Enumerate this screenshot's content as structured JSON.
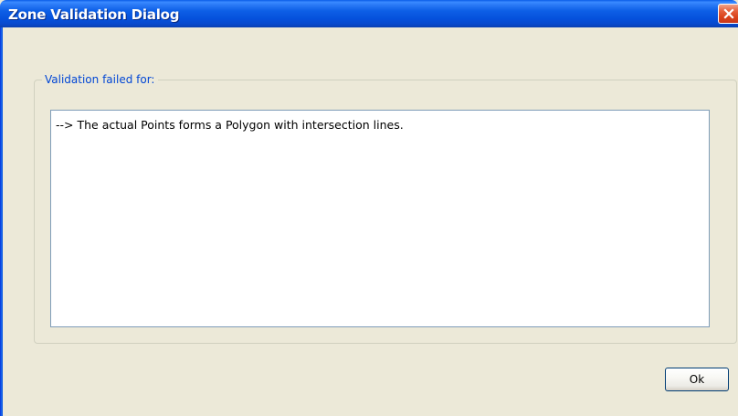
{
  "window": {
    "title": "Zone Validation Dialog"
  },
  "titlebar": {
    "close_icon": "close-icon"
  },
  "group": {
    "legend": "Validation failed for:"
  },
  "messages": {
    "text": "--> The actual Points forms a Polygon with intersection lines."
  },
  "buttons": {
    "ok_label": "Ok"
  },
  "colors": {
    "titlebar": "#0a5ce8",
    "window_bg": "#ece9d8",
    "legend_text": "#0046d5",
    "close_button": "#d9421a"
  }
}
